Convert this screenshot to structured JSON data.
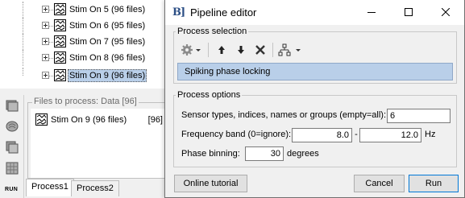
{
  "tree": {
    "items": [
      {
        "label": "Stim On 5 (96 files)",
        "selected": false
      },
      {
        "label": "Stim On 6 (95 files)",
        "selected": false
      },
      {
        "label": "Stim On 7 (95 files)",
        "selected": false
      },
      {
        "label": "Stim On 8 (96 files)",
        "selected": false
      },
      {
        "label": "Stim On 9 (96 files)",
        "selected": true
      }
    ]
  },
  "files_panel": {
    "title": "Files to process: Data [96]",
    "row": {
      "name": "Stim On 9 (96 files)",
      "count": "[96]"
    }
  },
  "sidebar": {
    "run_label": "RUN"
  },
  "process_tabs": [
    "Process1",
    "Process2"
  ],
  "editor": {
    "title": "Pipeline editor",
    "app_icon_text": "B]",
    "process_selection": {
      "title": "Process selection",
      "selected_process": "Spiking phase locking"
    },
    "process_options": {
      "title": "Process options",
      "sensor_label": "Sensor types, indices, names or groups (empty=all):",
      "sensor_value": "6",
      "freq_label": "Frequency band (0=ignore):",
      "freq_low": "8.0",
      "freq_sep": "-",
      "freq_high": "12.0",
      "freq_unit": "Hz",
      "phase_label": "Phase binning:",
      "phase_value": "30",
      "phase_unit": "degrees"
    },
    "buttons": {
      "tutorial": "Online tutorial",
      "cancel": "Cancel",
      "run": "Run"
    }
  },
  "colors": {
    "selection": "#b9cfe9",
    "brand": "#2c4f85",
    "focus": "#0078d7"
  }
}
